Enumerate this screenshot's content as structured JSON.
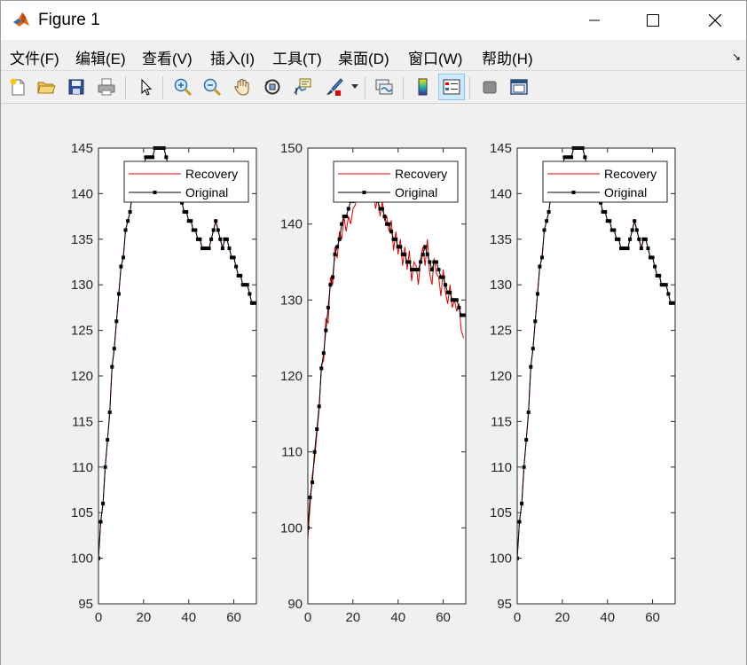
{
  "window": {
    "title": "Figure 1"
  },
  "menu": {
    "items": [
      {
        "label": "文件(F)",
        "key": "file"
      },
      {
        "label": "编辑(E)",
        "key": "edit"
      },
      {
        "label": "查看(V)",
        "key": "view"
      },
      {
        "label": "插入(I)",
        "key": "insert"
      },
      {
        "label": "工具(T)",
        "key": "tools"
      },
      {
        "label": "桌面(D)",
        "key": "desktop"
      },
      {
        "label": "窗口(W)",
        "key": "window"
      },
      {
        "label": "帮助(H)",
        "key": "help"
      }
    ],
    "dock_arrow": "↘"
  },
  "toolbar": {
    "buttons": [
      {
        "icon": "new-figure-icon"
      },
      {
        "icon": "open-file-icon"
      },
      {
        "icon": "save-icon"
      },
      {
        "icon": "print-icon"
      },
      {
        "icon": "edit-plot-icon"
      },
      {
        "icon": "zoom-in-icon"
      },
      {
        "icon": "zoom-out-icon"
      },
      {
        "icon": "pan-icon"
      },
      {
        "icon": "rotate-3d-icon"
      },
      {
        "icon": "data-cursor-icon"
      },
      {
        "icon": "brush-icon"
      },
      {
        "icon": "link-plot-icon"
      },
      {
        "icon": "insert-colorbar-icon"
      },
      {
        "icon": "insert-legend-icon"
      },
      {
        "icon": "hide-plot-tools-icon"
      },
      {
        "icon": "show-plot-tools-icon"
      }
    ],
    "active_button": "insert-legend-icon"
  },
  "colors": {
    "recovery": "#e00000",
    "original": "#000000",
    "background": "#f0f0f0",
    "axes_bg": "#ffffff"
  },
  "chart_data": [
    {
      "type": "line",
      "xlim": [
        0,
        70
      ],
      "ylim": [
        95,
        145
      ],
      "xticks": [
        0,
        20,
        40,
        60
      ],
      "yticks": [
        95,
        100,
        105,
        110,
        115,
        120,
        125,
        130,
        135,
        140,
        145
      ],
      "legend": {
        "position": "top-right",
        "entries": [
          "Recovery",
          "Original"
        ]
      },
      "grid": false,
      "series": [
        {
          "name": "Recovery",
          "color": "#e00000",
          "marker": "none",
          "x": [
            0,
            1,
            2,
            3,
            4,
            5,
            6,
            7,
            8,
            9,
            10,
            11,
            12,
            13,
            14,
            15,
            16,
            17,
            18,
            19,
            20,
            21,
            22,
            23,
            24,
            25,
            26,
            27,
            28,
            29,
            30,
            31,
            32,
            33,
            34,
            35,
            36,
            37,
            38,
            39,
            40,
            41,
            42,
            43,
            44,
            45,
            46,
            47,
            48,
            49,
            50,
            51,
            52,
            53,
            54,
            55,
            56,
            57,
            58,
            59,
            60,
            61,
            62,
            63,
            64,
            65,
            66,
            67,
            68,
            69
          ],
          "y": [
            100,
            104,
            106,
            110,
            113,
            116,
            121,
            123,
            126,
            129,
            132,
            133,
            136,
            137,
            138,
            140,
            141,
            141,
            142,
            143,
            143,
            144,
            144,
            144,
            144,
            145,
            145,
            145,
            145,
            145,
            144,
            143,
            142,
            142,
            141,
            140,
            140,
            139,
            138,
            138,
            137,
            137,
            136,
            136,
            135,
            135,
            134,
            134,
            134,
            134,
            135,
            136,
            137,
            136,
            135,
            134,
            135,
            135,
            134,
            133,
            133,
            132,
            131,
            131,
            130,
            130,
            130,
            129,
            128,
            128
          ]
        },
        {
          "name": "Original",
          "color": "#000000",
          "marker": "square",
          "x": [
            0,
            1,
            2,
            3,
            4,
            5,
            6,
            7,
            8,
            9,
            10,
            11,
            12,
            13,
            14,
            15,
            16,
            17,
            18,
            19,
            20,
            21,
            22,
            23,
            24,
            25,
            26,
            27,
            28,
            29,
            30,
            31,
            32,
            33,
            34,
            35,
            36,
            37,
            38,
            39,
            40,
            41,
            42,
            43,
            44,
            45,
            46,
            47,
            48,
            49,
            50,
            51,
            52,
            53,
            54,
            55,
            56,
            57,
            58,
            59,
            60,
            61,
            62,
            63,
            64,
            65,
            66,
            67,
            68,
            69
          ],
          "y": [
            100,
            104,
            106,
            110,
            113,
            116,
            121,
            123,
            126,
            129,
            132,
            133,
            136,
            137,
            138,
            140,
            141,
            141,
            142,
            143,
            143,
            144,
            144,
            144,
            144,
            145,
            145,
            145,
            145,
            145,
            144,
            143,
            142,
            142,
            141,
            140,
            140,
            139,
            138,
            138,
            137,
            137,
            136,
            136,
            135,
            135,
            134,
            134,
            134,
            134,
            135,
            136,
            137,
            136,
            135,
            134,
            135,
            135,
            134,
            133,
            133,
            132,
            131,
            131,
            130,
            130,
            130,
            129,
            128,
            128
          ]
        }
      ]
    },
    {
      "type": "line",
      "xlim": [
        0,
        70
      ],
      "ylim": [
        90,
        150
      ],
      "xticks": [
        0,
        20,
        40,
        60
      ],
      "yticks": [
        90,
        100,
        110,
        120,
        130,
        140,
        150
      ],
      "legend": {
        "position": "top-right",
        "entries": [
          "Recovery",
          "Original"
        ]
      },
      "grid": false,
      "series": [
        {
          "name": "Recovery",
          "color": "#e00000",
          "marker": "none",
          "x": [
            0,
            1,
            2,
            3,
            4,
            5,
            6,
            7,
            8,
            9,
            10,
            11,
            12,
            13,
            14,
            15,
            16,
            17,
            18,
            19,
            20,
            21,
            22,
            23,
            24,
            25,
            26,
            27,
            28,
            29,
            30,
            31,
            32,
            33,
            34,
            35,
            36,
            37,
            38,
            39,
            40,
            41,
            42,
            43,
            44,
            45,
            46,
            47,
            48,
            49,
            50,
            51,
            52,
            53,
            54,
            55,
            56,
            57,
            58,
            59,
            60,
            61,
            62,
            63,
            64,
            65,
            66,
            67,
            68,
            69
          ],
          "y": [
            98.5,
            103,
            107,
            109,
            112.5,
            115.5,
            121.5,
            122,
            127.5,
            127,
            133,
            132,
            137,
            135.5,
            139,
            138,
            141,
            139,
            141,
            140,
            142,
            142.5,
            144,
            143,
            143.5,
            145,
            144,
            145,
            143.5,
            145,
            142,
            143.5,
            141,
            143,
            140.5,
            141,
            139,
            140.5,
            136.5,
            139,
            136,
            138,
            134.5,
            137,
            134,
            136.5,
            132.5,
            135,
            134.5,
            132,
            135.5,
            137,
            134.5,
            138,
            133.5,
            132,
            135.5,
            133.5,
            133,
            130.5,
            134,
            131,
            129.5,
            132,
            129,
            130,
            128.5,
            129.5,
            126,
            125
          ]
        },
        {
          "name": "Original",
          "color": "#000000",
          "marker": "square",
          "x": [
            0,
            1,
            2,
            3,
            4,
            5,
            6,
            7,
            8,
            9,
            10,
            11,
            12,
            13,
            14,
            15,
            16,
            17,
            18,
            19,
            20,
            21,
            22,
            23,
            24,
            25,
            26,
            27,
            28,
            29,
            30,
            31,
            32,
            33,
            34,
            35,
            36,
            37,
            38,
            39,
            40,
            41,
            42,
            43,
            44,
            45,
            46,
            47,
            48,
            49,
            50,
            51,
            52,
            53,
            54,
            55,
            56,
            57,
            58,
            59,
            60,
            61,
            62,
            63,
            64,
            65,
            66,
            67,
            68,
            69
          ],
          "y": [
            100,
            104,
            106,
            110,
            113,
            116,
            121,
            123,
            126,
            129,
            132,
            133,
            136,
            137,
            138,
            140,
            141,
            141,
            142,
            143,
            143,
            144,
            144,
            144,
            144,
            145,
            145,
            145,
            145,
            145,
            144,
            143,
            142,
            142,
            141,
            140,
            140,
            139,
            138,
            138,
            137,
            137,
            136,
            136,
            135,
            135,
            134,
            134,
            134,
            134,
            135,
            136,
            137,
            136,
            135,
            134,
            135,
            135,
            134,
            133,
            133,
            132,
            131,
            131,
            130,
            130,
            130,
            129,
            128,
            128
          ]
        }
      ]
    },
    {
      "type": "line",
      "xlim": [
        0,
        70
      ],
      "ylim": [
        95,
        145
      ],
      "xticks": [
        0,
        20,
        40,
        60
      ],
      "yticks": [
        95,
        100,
        105,
        110,
        115,
        120,
        125,
        130,
        135,
        140,
        145
      ],
      "legend": {
        "position": "top-right",
        "entries": [
          "Recovery",
          "Original"
        ]
      },
      "grid": false,
      "series": [
        {
          "name": "Recovery",
          "color": "#e00000",
          "marker": "none",
          "x": [
            0,
            1,
            2,
            3,
            4,
            5,
            6,
            7,
            8,
            9,
            10,
            11,
            12,
            13,
            14,
            15,
            16,
            17,
            18,
            19,
            20,
            21,
            22,
            23,
            24,
            25,
            26,
            27,
            28,
            29,
            30,
            31,
            32,
            33,
            34,
            35,
            36,
            37,
            38,
            39,
            40,
            41,
            42,
            43,
            44,
            45,
            46,
            47,
            48,
            49,
            50,
            51,
            52,
            53,
            54,
            55,
            56,
            57,
            58,
            59,
            60,
            61,
            62,
            63,
            64,
            65,
            66,
            67,
            68,
            69
          ],
          "y": [
            100,
            104,
            106,
            110,
            113,
            116,
            121,
            123,
            126,
            129,
            132,
            133,
            136,
            137,
            138,
            140,
            141,
            141,
            142,
            143,
            143,
            144,
            144,
            144,
            144,
            145,
            145,
            145,
            145,
            145,
            144,
            143,
            142,
            142,
            141,
            140,
            140,
            139,
            138,
            138,
            137,
            137,
            136,
            136,
            135,
            135,
            134,
            134,
            134,
            134,
            135,
            136,
            137,
            136,
            135,
            134,
            135,
            135,
            134,
            133,
            133,
            132,
            131,
            131,
            130,
            130,
            130,
            129,
            128,
            128
          ]
        },
        {
          "name": "Original",
          "color": "#000000",
          "marker": "square",
          "x": [
            0,
            1,
            2,
            3,
            4,
            5,
            6,
            7,
            8,
            9,
            10,
            11,
            12,
            13,
            14,
            15,
            16,
            17,
            18,
            19,
            20,
            21,
            22,
            23,
            24,
            25,
            26,
            27,
            28,
            29,
            30,
            31,
            32,
            33,
            34,
            35,
            36,
            37,
            38,
            39,
            40,
            41,
            42,
            43,
            44,
            45,
            46,
            47,
            48,
            49,
            50,
            51,
            52,
            53,
            54,
            55,
            56,
            57,
            58,
            59,
            60,
            61,
            62,
            63,
            64,
            65,
            66,
            67,
            68,
            69
          ],
          "y": [
            100,
            104,
            106,
            110,
            113,
            116,
            121,
            123,
            126,
            129,
            132,
            133,
            136,
            137,
            138,
            140,
            141,
            141,
            142,
            143,
            143,
            144,
            144,
            144,
            144,
            145,
            145,
            145,
            145,
            145,
            144,
            143,
            142,
            142,
            141,
            140,
            140,
            139,
            138,
            138,
            137,
            137,
            136,
            136,
            135,
            135,
            134,
            134,
            134,
            134,
            135,
            136,
            137,
            136,
            135,
            134,
            135,
            135,
            134,
            133,
            133,
            132,
            131,
            131,
            130,
            130,
            130,
            129,
            128,
            128
          ]
        }
      ]
    }
  ]
}
